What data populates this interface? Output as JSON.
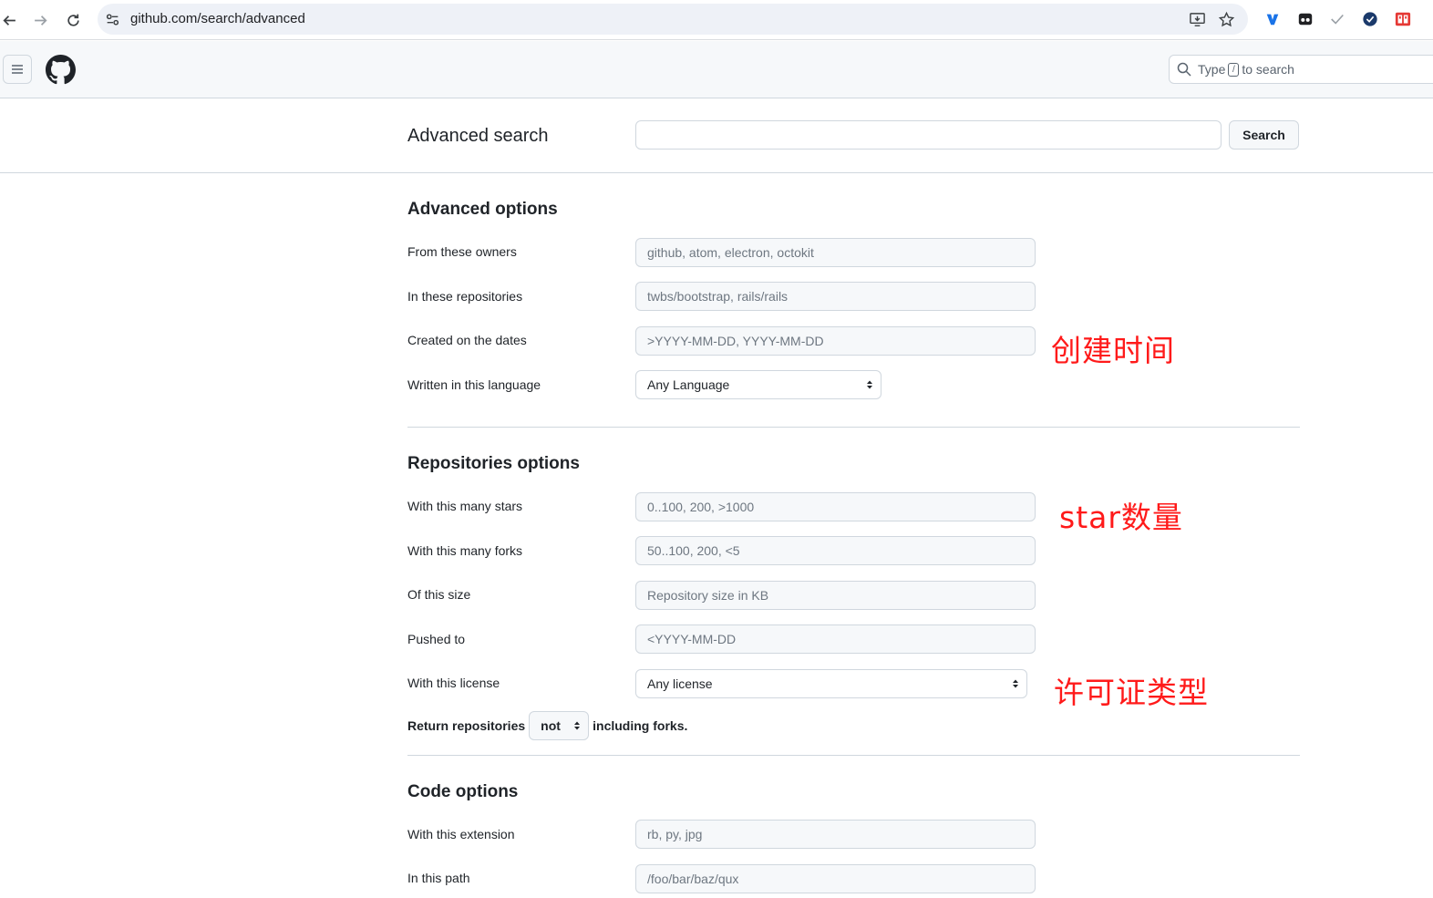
{
  "browser": {
    "url": "github.com/search/advanced"
  },
  "header": {
    "search_placeholder_prefix": "Type",
    "search_shortcut_key": "/",
    "search_placeholder_suffix": "to search"
  },
  "top": {
    "title": "Advanced search",
    "query_value": "",
    "search_button": "Search"
  },
  "advanced_options": {
    "title": "Advanced options",
    "owners_label": "From these owners",
    "owners_placeholder": "github, atom, electron, octokit",
    "repos_label": "In these repositories",
    "repos_placeholder": "twbs/bootstrap, rails/rails",
    "dates_label": "Created on the dates",
    "dates_placeholder": ">YYYY-MM-DD, YYYY-MM-DD",
    "language_label": "Written in this language",
    "language_value": "Any Language"
  },
  "repositories_options": {
    "title": "Repositories options",
    "stars_label": "With this many stars",
    "stars_placeholder": "0..100, 200, >1000",
    "forks_label": "With this many forks",
    "forks_placeholder": "50..100, 200, <5",
    "size_label": "Of this size",
    "size_placeholder": "Repository size in KB",
    "pushed_label": "Pushed to",
    "pushed_placeholder": "<YYYY-MM-DD",
    "license_label": "With this license",
    "license_value": "Any license",
    "return_prefix": "Return repositories",
    "return_value": "not",
    "return_suffix": "including forks."
  },
  "code_options": {
    "title": "Code options",
    "extension_label": "With this extension",
    "extension_placeholder": "rb, py, jpg",
    "path_label": "In this path",
    "path_placeholder": "/foo/bar/baz/qux"
  },
  "annotations": {
    "created_time": "创建时间",
    "star_count": "star数量",
    "license_type": "许可证类型",
    "color": "#ff1a1a"
  }
}
